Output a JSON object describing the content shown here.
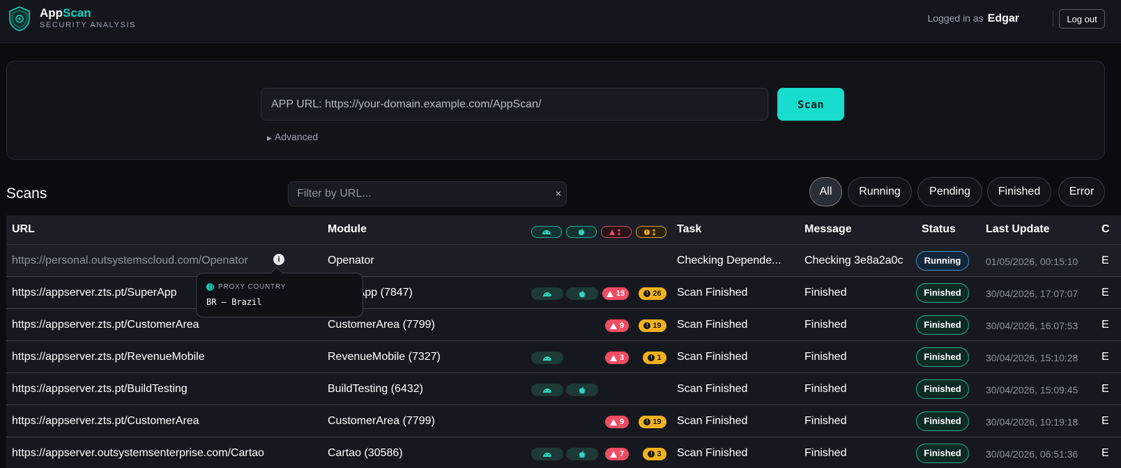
{
  "header": {
    "brand_app": "App",
    "brand_scan": "Scan",
    "subtitle": "SECURITY ANALYSIS",
    "logged_in_label": "Logged in as",
    "username": "Edgar",
    "logout_label": "Log out"
  },
  "scan_form": {
    "url_placeholder": "APP URL: https://your-domain.example.com/AppScan/",
    "scan_label": "Scan",
    "advanced_label": "Advanced"
  },
  "scans": {
    "title": "Scans",
    "filter_placeholder": "Filter by URL...",
    "clear_icon": "×",
    "filters": [
      "All",
      "Running",
      "Pending",
      "Finished",
      "Error"
    ],
    "active_filter": "All"
  },
  "table": {
    "headers": {
      "url": "URL",
      "module": "Module",
      "task": "Task",
      "message": "Message",
      "status": "Status",
      "last_update": "Last Update",
      "extra": "C"
    },
    "rows": [
      {
        "url": "https://personal.outsystemscloud.com/Openator",
        "module": "Openator",
        "android": false,
        "apple": false,
        "crit": "",
        "warn": "",
        "task": "Checking Depende...",
        "message": "Checking 3e8a2a0c",
        "status": "Running",
        "date": "01/05/2026, 00:15:10",
        "extra": "E"
      },
      {
        "url": "https://appserver.zts.pt/SuperApp",
        "module": "SuperApp (7847)",
        "android": true,
        "apple": true,
        "crit": "15",
        "warn": "26",
        "task": "Scan Finished",
        "message": "Finished",
        "status": "Finished",
        "date": "30/04/2026, 17:07:07",
        "extra": "E"
      },
      {
        "url": "https://appserver.zts.pt/CustomerArea",
        "module": "CustomerArea (7799)",
        "android": false,
        "apple": false,
        "crit": "9",
        "warn": "19",
        "task": "Scan Finished",
        "message": "Finished",
        "status": "Finished",
        "date": "30/04/2026, 16:07:53",
        "extra": "E"
      },
      {
        "url": "https://appserver.zts.pt/RevenueMobile",
        "module": "RevenueMobile (7327)",
        "android": true,
        "apple": false,
        "crit": "3",
        "warn": "1",
        "task": "Scan Finished",
        "message": "Finished",
        "status": "Finished",
        "date": "30/04/2026, 15:10:28",
        "extra": "E"
      },
      {
        "url": "https://appserver.zts.pt/BuildTesting",
        "module": "BuildTesting (6432)",
        "android": true,
        "apple": true,
        "crit": "",
        "warn": "",
        "task": "Scan Finished",
        "message": "Finished",
        "status": "Finished",
        "date": "30/04/2026, 15:09:45",
        "extra": "E"
      },
      {
        "url": "https://appserver.zts.pt/CustomerArea",
        "module": "CustomerArea (7799)",
        "android": false,
        "apple": false,
        "crit": "9",
        "warn": "19",
        "task": "Scan Finished",
        "message": "Finished",
        "status": "Finished",
        "date": "30/04/2026, 10:19:18",
        "extra": "E"
      },
      {
        "url": "https://appserver.outsystemsenterprise.com/Cartao",
        "module": "Cartao (30586)",
        "android": true,
        "apple": true,
        "crit": "7",
        "warn": "3",
        "task": "Scan Finished",
        "message": "Finished",
        "status": "Finished",
        "date": "30/04/2026, 06:51:36",
        "extra": "E"
      }
    ]
  },
  "tooltip": {
    "label": "PROXY COUNTRY",
    "value": "BR — Brazil"
  },
  "colors": {
    "accent": "#19d3c5",
    "critical": "#ee4d66",
    "warning": "#f2b21d",
    "running_border": "#4a90c6",
    "finished_border": "#21b08e"
  }
}
